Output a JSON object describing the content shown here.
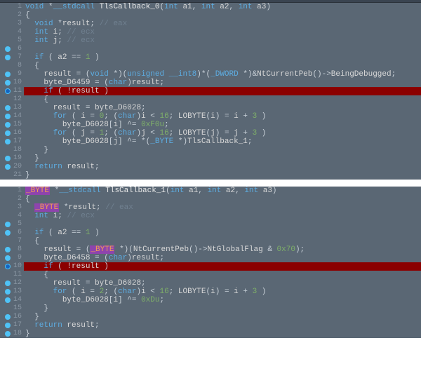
{
  "panel1": {
    "lines": [
      {
        "n": "1",
        "bp": false,
        "tokens": [
          [
            "type",
            "void "
          ],
          [
            "op",
            "*"
          ],
          [
            "kw",
            "__stdcall "
          ],
          [
            "fn-name",
            "TlsCallback_0"
          ],
          [
            "paren",
            "("
          ],
          [
            "type",
            "int "
          ],
          [
            "ident",
            "a1"
          ],
          [
            "paren",
            ", "
          ],
          [
            "type",
            "int "
          ],
          [
            "ident",
            "a2"
          ],
          [
            "paren",
            ", "
          ],
          [
            "type",
            "int "
          ],
          [
            "ident",
            "a3"
          ],
          [
            "paren",
            ")"
          ]
        ]
      },
      {
        "n": "2",
        "bp": false,
        "tokens": [
          [
            "paren",
            "{"
          ]
        ]
      },
      {
        "n": "3",
        "bp": false,
        "tokens": [
          [
            "ident",
            "  "
          ],
          [
            "type",
            "void "
          ],
          [
            "op",
            "*"
          ],
          [
            "ident",
            "result"
          ],
          [
            "paren",
            "; "
          ],
          [
            "comment",
            "// eax"
          ]
        ]
      },
      {
        "n": "4",
        "bp": false,
        "tokens": [
          [
            "ident",
            "  "
          ],
          [
            "type",
            "int "
          ],
          [
            "ident",
            "i"
          ],
          [
            "paren",
            "; "
          ],
          [
            "comment",
            "// ecx"
          ]
        ]
      },
      {
        "n": "5",
        "bp": false,
        "tokens": [
          [
            "ident",
            "  "
          ],
          [
            "type",
            "int "
          ],
          [
            "ident",
            "j"
          ],
          [
            "paren",
            "; "
          ],
          [
            "comment",
            "// ecx"
          ]
        ]
      },
      {
        "n": "6",
        "bp": true,
        "tokens": []
      },
      {
        "n": "7",
        "bp": true,
        "tokens": [
          [
            "ident",
            "  "
          ],
          [
            "kw",
            "if "
          ],
          [
            "paren",
            "( "
          ],
          [
            "ident",
            "a2"
          ],
          [
            "op",
            " == "
          ],
          [
            "num",
            "1"
          ],
          [
            "paren",
            " )"
          ]
        ]
      },
      {
        "n": "8",
        "bp": false,
        "tokens": [
          [
            "paren",
            "  {"
          ]
        ]
      },
      {
        "n": "9",
        "bp": true,
        "tokens": [
          [
            "ident",
            "    "
          ],
          [
            "ident",
            "result"
          ],
          [
            "op",
            " = "
          ],
          [
            "paren",
            "("
          ],
          [
            "type",
            "void "
          ],
          [
            "op",
            "*"
          ],
          [
            "paren",
            ")("
          ],
          [
            "type",
            "unsigned __int8"
          ],
          [
            "paren",
            ")"
          ],
          [
            "op",
            "*"
          ],
          [
            "paren",
            "("
          ],
          [
            "type",
            "_DWORD "
          ],
          [
            "op",
            "*"
          ],
          [
            "paren",
            ")"
          ],
          [
            "op",
            "&"
          ],
          [
            "fn",
            "NtCurrentPeb"
          ],
          [
            "paren",
            "()"
          ],
          [
            "op",
            "->"
          ],
          [
            "ident",
            "BeingDebugged"
          ],
          [
            "paren",
            ";"
          ]
        ]
      },
      {
        "n": "10",
        "bp": true,
        "tokens": [
          [
            "ident",
            "    "
          ],
          [
            "ident",
            "byte_D6459"
          ],
          [
            "op",
            " = "
          ],
          [
            "paren",
            "("
          ],
          [
            "type",
            "char"
          ],
          [
            "paren",
            ")"
          ],
          [
            "ident",
            "result"
          ],
          [
            "paren",
            ";"
          ]
        ]
      },
      {
        "n": "11",
        "bp": "dark",
        "hl": "red",
        "tokens": [
          [
            "ident",
            "    "
          ],
          [
            "kw",
            "if "
          ],
          [
            "paren",
            "( "
          ],
          [
            "op",
            "!"
          ],
          [
            "ident",
            "result"
          ],
          [
            "paren",
            " )"
          ]
        ]
      },
      {
        "n": "12",
        "bp": false,
        "tokens": [
          [
            "paren",
            "    {"
          ]
        ]
      },
      {
        "n": "13",
        "bp": true,
        "tokens": [
          [
            "ident",
            "      "
          ],
          [
            "ident",
            "result"
          ],
          [
            "op",
            " = "
          ],
          [
            "ident",
            "byte_D6028"
          ],
          [
            "paren",
            ";"
          ]
        ]
      },
      {
        "n": "14",
        "bp": true,
        "tokens": [
          [
            "ident",
            "      "
          ],
          [
            "kw",
            "for "
          ],
          [
            "paren",
            "( "
          ],
          [
            "ident",
            "i"
          ],
          [
            "op",
            " = "
          ],
          [
            "num",
            "0"
          ],
          [
            "paren",
            "; ("
          ],
          [
            "type",
            "char"
          ],
          [
            "paren",
            ")"
          ],
          [
            "ident",
            "i"
          ],
          [
            "op",
            " < "
          ],
          [
            "num",
            "16"
          ],
          [
            "paren",
            "; "
          ],
          [
            "fn",
            "LOBYTE"
          ],
          [
            "paren",
            "("
          ],
          [
            "ident",
            "i"
          ],
          [
            "paren",
            ")"
          ],
          [
            "op",
            " = "
          ],
          [
            "ident",
            "i"
          ],
          [
            "op",
            " + "
          ],
          [
            "num",
            "3"
          ],
          [
            "paren",
            " )"
          ]
        ]
      },
      {
        "n": "15",
        "bp": true,
        "tokens": [
          [
            "ident",
            "        "
          ],
          [
            "ident",
            "byte_D6028"
          ],
          [
            "paren",
            "["
          ],
          [
            "ident",
            "i"
          ],
          [
            "paren",
            "]"
          ],
          [
            "op",
            " ^= "
          ],
          [
            "num",
            "0xF0u"
          ],
          [
            "paren",
            ";"
          ]
        ]
      },
      {
        "n": "16",
        "bp": true,
        "tokens": [
          [
            "ident",
            "      "
          ],
          [
            "kw",
            "for "
          ],
          [
            "paren",
            "( "
          ],
          [
            "ident",
            "j"
          ],
          [
            "op",
            " = "
          ],
          [
            "num",
            "1"
          ],
          [
            "paren",
            "; ("
          ],
          [
            "type",
            "char"
          ],
          [
            "paren",
            ")"
          ],
          [
            "ident",
            "j"
          ],
          [
            "op",
            " < "
          ],
          [
            "num",
            "16"
          ],
          [
            "paren",
            "; "
          ],
          [
            "fn",
            "LOBYTE"
          ],
          [
            "paren",
            "("
          ],
          [
            "ident",
            "j"
          ],
          [
            "paren",
            ")"
          ],
          [
            "op",
            " = "
          ],
          [
            "ident",
            "j"
          ],
          [
            "op",
            " + "
          ],
          [
            "num",
            "3"
          ],
          [
            "paren",
            " )"
          ]
        ]
      },
      {
        "n": "17",
        "bp": true,
        "tokens": [
          [
            "ident",
            "        "
          ],
          [
            "ident",
            "byte_D6028"
          ],
          [
            "paren",
            "["
          ],
          [
            "ident",
            "j"
          ],
          [
            "paren",
            "]"
          ],
          [
            "op",
            " ^= *("
          ],
          [
            "type",
            "_BYTE "
          ],
          [
            "op",
            "*"
          ],
          [
            "paren",
            ")"
          ],
          [
            "ident",
            "TlsCallback_1"
          ],
          [
            "paren",
            ";"
          ]
        ]
      },
      {
        "n": "18",
        "bp": false,
        "tokens": [
          [
            "paren",
            "    }"
          ]
        ]
      },
      {
        "n": "19",
        "bp": true,
        "tokens": [
          [
            "paren",
            "  }"
          ]
        ]
      },
      {
        "n": "20",
        "bp": true,
        "tokens": [
          [
            "ident",
            "  "
          ],
          [
            "kw",
            "return "
          ],
          [
            "ident",
            "result"
          ],
          [
            "paren",
            ";"
          ]
        ]
      },
      {
        "n": "21",
        "bp": false,
        "tokens": [
          [
            "paren",
            "}"
          ]
        ]
      }
    ]
  },
  "panel2": {
    "lines": [
      {
        "n": "1",
        "bp": false,
        "tokens": [
          [
            "hl-type",
            "_BYTE"
          ],
          [
            "type",
            " "
          ],
          [
            "op",
            "*"
          ],
          [
            "kw",
            "__stdcall "
          ],
          [
            "fn-name",
            "TlsCallback_1"
          ],
          [
            "paren",
            "("
          ],
          [
            "type",
            "int "
          ],
          [
            "ident",
            "a1"
          ],
          [
            "paren",
            ", "
          ],
          [
            "type",
            "int "
          ],
          [
            "ident",
            "a2"
          ],
          [
            "paren",
            ", "
          ],
          [
            "type",
            "int "
          ],
          [
            "ident",
            "a3"
          ],
          [
            "paren",
            ")"
          ]
        ]
      },
      {
        "n": "2",
        "bp": false,
        "tokens": [
          [
            "paren",
            "{"
          ]
        ]
      },
      {
        "n": "3",
        "bp": false,
        "tokens": [
          [
            "ident",
            "  "
          ],
          [
            "hl-type",
            "_BYTE"
          ],
          [
            "type",
            " "
          ],
          [
            "op",
            "*"
          ],
          [
            "ident",
            "result"
          ],
          [
            "paren",
            "; "
          ],
          [
            "comment",
            "// eax"
          ]
        ]
      },
      {
        "n": "4",
        "bp": false,
        "tokens": [
          [
            "ident",
            "  "
          ],
          [
            "type",
            "int "
          ],
          [
            "ident",
            "i"
          ],
          [
            "paren",
            "; "
          ],
          [
            "comment",
            "// ecx"
          ]
        ]
      },
      {
        "n": "5",
        "bp": true,
        "tokens": []
      },
      {
        "n": "6",
        "bp": true,
        "tokens": [
          [
            "ident",
            "  "
          ],
          [
            "kw",
            "if "
          ],
          [
            "paren",
            "( "
          ],
          [
            "ident",
            "a2"
          ],
          [
            "op",
            " == "
          ],
          [
            "num",
            "1"
          ],
          [
            "paren",
            " )"
          ]
        ]
      },
      {
        "n": "7",
        "bp": false,
        "tokens": [
          [
            "paren",
            "  {"
          ]
        ]
      },
      {
        "n": "8",
        "bp": true,
        "tokens": [
          [
            "ident",
            "    "
          ],
          [
            "ident",
            "result"
          ],
          [
            "op",
            " = "
          ],
          [
            "paren",
            "("
          ],
          [
            "hl-type",
            "_BYTE"
          ],
          [
            "type",
            " "
          ],
          [
            "op",
            "*"
          ],
          [
            "paren",
            ")("
          ],
          [
            "fn",
            "NtCurrentPeb"
          ],
          [
            "paren",
            "()"
          ],
          [
            "op",
            "->"
          ],
          [
            "ident",
            "NtGlobalFlag"
          ],
          [
            "op",
            " & "
          ],
          [
            "num",
            "0x70"
          ],
          [
            "paren",
            ");"
          ]
        ]
      },
      {
        "n": "9",
        "bp": true,
        "tokens": [
          [
            "ident",
            "    "
          ],
          [
            "ident",
            "byte_D6458"
          ],
          [
            "op",
            " = "
          ],
          [
            "paren",
            "("
          ],
          [
            "type",
            "char"
          ],
          [
            "paren",
            ")"
          ],
          [
            "ident",
            "result"
          ],
          [
            "paren",
            ";"
          ]
        ]
      },
      {
        "n": "10",
        "bp": "dark",
        "hl": "red",
        "tokens": [
          [
            "ident",
            "    "
          ],
          [
            "kw",
            "if "
          ],
          [
            "paren",
            "( "
          ],
          [
            "op",
            "!"
          ],
          [
            "ident",
            "result"
          ],
          [
            "paren",
            " )"
          ]
        ]
      },
      {
        "n": "11",
        "bp": false,
        "tokens": [
          [
            "paren",
            "    {"
          ]
        ]
      },
      {
        "n": "12",
        "bp": true,
        "tokens": [
          [
            "ident",
            "      "
          ],
          [
            "ident",
            "result"
          ],
          [
            "op",
            " = "
          ],
          [
            "ident",
            "byte_D6028"
          ],
          [
            "paren",
            ";"
          ]
        ]
      },
      {
        "n": "13",
        "bp": true,
        "tokens": [
          [
            "ident",
            "      "
          ],
          [
            "kw",
            "for "
          ],
          [
            "paren",
            "( "
          ],
          [
            "ident",
            "i"
          ],
          [
            "op",
            " = "
          ],
          [
            "num",
            "2"
          ],
          [
            "paren",
            "; ("
          ],
          [
            "type",
            "char"
          ],
          [
            "paren",
            ")"
          ],
          [
            "ident",
            "i"
          ],
          [
            "op",
            " < "
          ],
          [
            "num",
            "16"
          ],
          [
            "paren",
            "; "
          ],
          [
            "fn",
            "LOBYTE"
          ],
          [
            "paren",
            "("
          ],
          [
            "ident",
            "i"
          ],
          [
            "paren",
            ")"
          ],
          [
            "op",
            " = "
          ],
          [
            "ident",
            "i"
          ],
          [
            "op",
            " + "
          ],
          [
            "num",
            "3"
          ],
          [
            "paren",
            " )"
          ]
        ]
      },
      {
        "n": "14",
        "bp": true,
        "tokens": [
          [
            "ident",
            "        "
          ],
          [
            "ident",
            "byte_D6028"
          ],
          [
            "paren",
            "["
          ],
          [
            "ident",
            "i"
          ],
          [
            "paren",
            "]"
          ],
          [
            "op",
            " ^= "
          ],
          [
            "num",
            "0xDu"
          ],
          [
            "paren",
            ";"
          ]
        ]
      },
      {
        "n": "15",
        "bp": false,
        "tokens": [
          [
            "paren",
            "    }"
          ]
        ]
      },
      {
        "n": "16",
        "bp": true,
        "tokens": [
          [
            "paren",
            "  }"
          ]
        ]
      },
      {
        "n": "17",
        "bp": true,
        "tokens": [
          [
            "ident",
            "  "
          ],
          [
            "kw",
            "return "
          ],
          [
            "ident",
            "result"
          ],
          [
            "paren",
            ";"
          ]
        ]
      },
      {
        "n": "18",
        "bp": true,
        "tokens": [
          [
            "paren",
            "}"
          ]
        ]
      }
    ]
  }
}
